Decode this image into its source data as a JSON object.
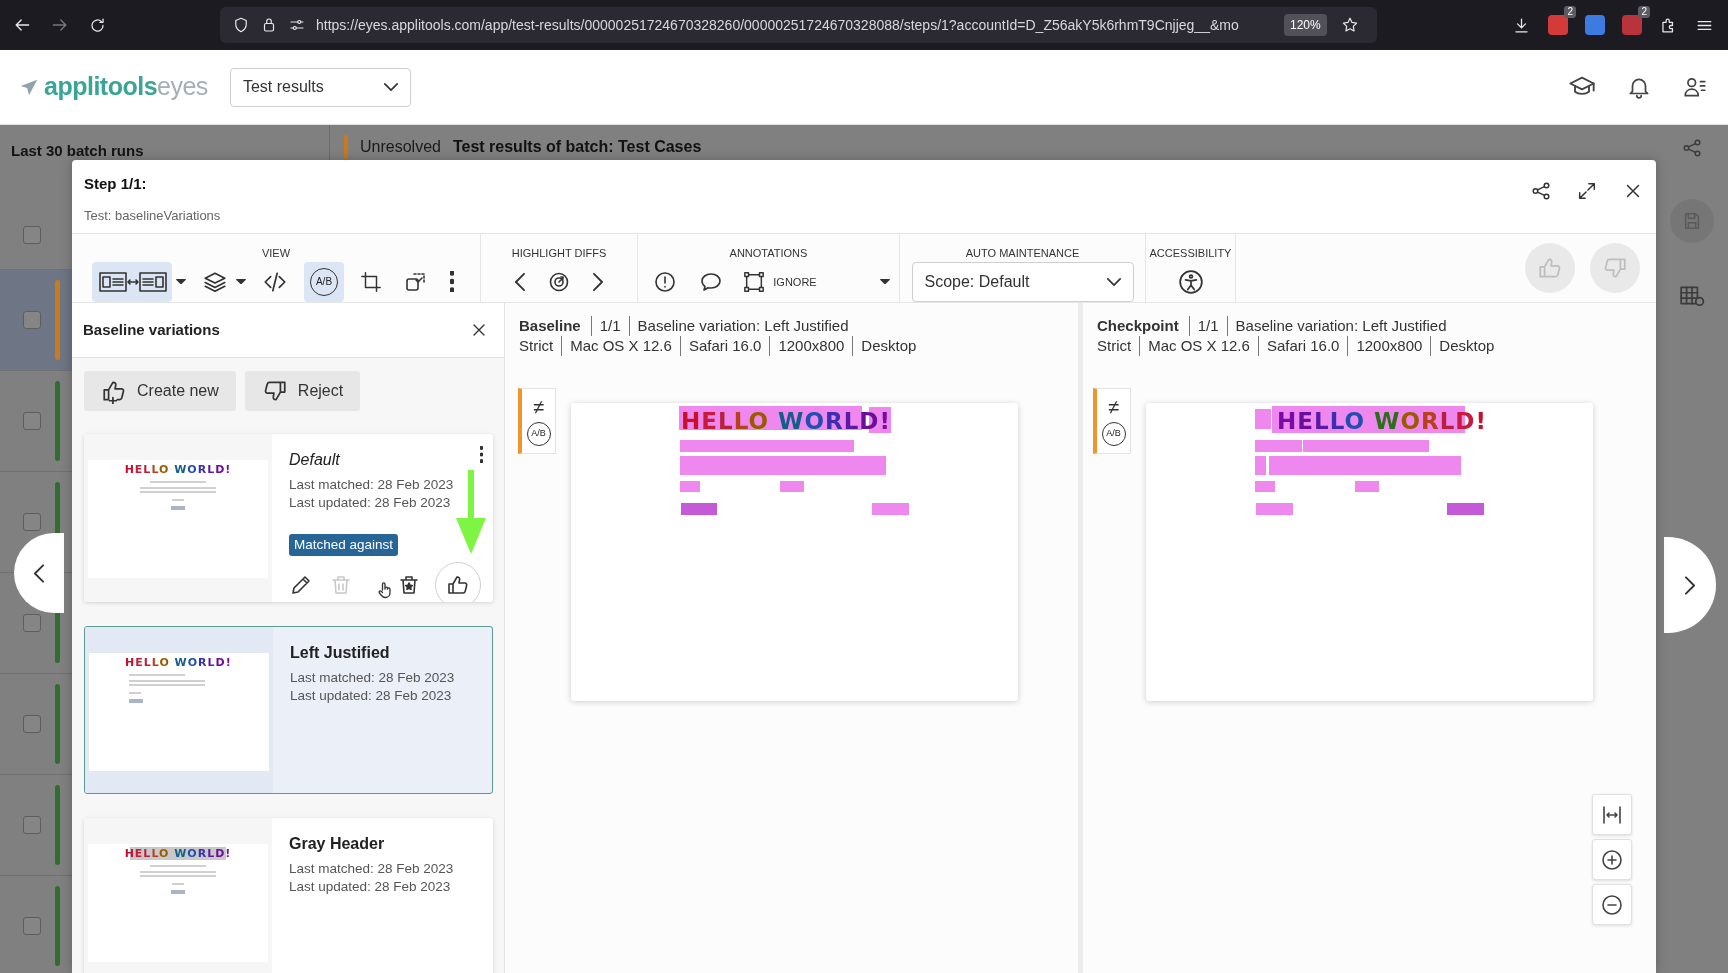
{
  "browser": {
    "url": "https://eyes.applitools.com/app/test-results/00000251724670328260/00000251724670328088/steps/1?accountId=D_Z56akY5k6rhmT9Cnjjeg__&mo",
    "zoom": "120%",
    "badges": [
      "2",
      "2"
    ]
  },
  "header": {
    "logo": "applitools",
    "logo_suffix": "eyes",
    "selector": "Test results"
  },
  "background": {
    "sidebar_title": "Last 30 batch runs",
    "status": "Unresolved",
    "title": "Test results of batch: Test Cases",
    "all_checked": false,
    "rows": [
      {
        "color": "#c97a1c",
        "selected": true,
        "checked": false
      },
      {
        "color": "#2f6e2f",
        "selected": false,
        "checked": false
      },
      {
        "color": "#2f6e2f",
        "selected": false,
        "checked": false
      },
      {
        "color": "#2f6e2f",
        "selected": false,
        "checked": false
      },
      {
        "color": "#2f6e2f",
        "selected": false,
        "checked": false
      },
      {
        "color": "#2f6e2f",
        "selected": false,
        "checked": false
      },
      {
        "color": "#2f6e2f",
        "selected": false,
        "checked": false
      }
    ]
  },
  "dialog": {
    "title": "Step 1/1:",
    "subtitle": "Test: baselineVariations",
    "toolbar": [
      {
        "label": "VIEW",
        "tools": [
          {
            "kind": "split",
            "selected": true,
            "dropdown": true
          },
          {
            "kind": "layers",
            "selected": false,
            "dropdown": true
          },
          {
            "kind": "code",
            "selected": false
          },
          {
            "kind": "ab",
            "text": "A/B",
            "selected": true
          },
          {
            "kind": "crop",
            "selected": false
          },
          {
            "kind": "region",
            "selected": false
          },
          {
            "kind": "more",
            "selected": false
          }
        ]
      },
      {
        "label": "HIGHLIGHT DIFFS",
        "tools": [
          {
            "kind": "prev"
          },
          {
            "kind": "target"
          },
          {
            "kind": "next"
          }
        ]
      },
      {
        "label": "ANNOTATIONS",
        "tools": [
          {
            "kind": "alert"
          },
          {
            "kind": "comment"
          },
          {
            "kind": "ignore",
            "text": "IGNORE"
          }
        ]
      },
      {
        "label": "AUTO MAINTENANCE",
        "tools": [
          {
            "kind": "select",
            "text": "Scope: Default"
          }
        ]
      },
      {
        "label": "ACCESSIBILITY",
        "tools": [
          {
            "kind": "accessibility"
          }
        ]
      }
    ],
    "panel": {
      "title": "Baseline variations",
      "actions": [
        {
          "kind": "approve",
          "label": "Create new"
        },
        {
          "kind": "reject",
          "label": "Reject"
        }
      ],
      "variations": [
        {
          "name": "Default",
          "kind": "default",
          "last_matched": "Last matched: 28 Feb 2023",
          "last_updated": "Last updated: 28 Feb 2023",
          "badge": "Matched against",
          "left_aligned": false,
          "gray_header": false,
          "heading": "HELLO WORLD!",
          "selected": false,
          "hovered": true,
          "arrow": true
        },
        {
          "name": "Left Justified",
          "kind": "custom",
          "last_matched": "Last matched: 28 Feb 2023",
          "last_updated": "Last updated: 28 Feb 2023",
          "left_aligned": true,
          "gray_header": false,
          "heading": "HELLO WORLD!",
          "selected": true,
          "hovered": false,
          "arrow": false
        },
        {
          "name": "Gray Header",
          "kind": "custom",
          "last_matched": "Last matched: 28 Feb 2023",
          "last_updated": "Last updated: 28 Feb 2023",
          "left_aligned": false,
          "gray_header": true,
          "heading": "HELLO WORLD!",
          "selected": false,
          "hovered": false,
          "arrow": false
        }
      ]
    },
    "panes": [
      {
        "kind": "baseline",
        "title": "Baseline",
        "index": "1/1",
        "variation": "Baseline variation: Left Justified",
        "details": [
          "Strict",
          "Mac OS X 12.6",
          "Safari 16.0",
          "1200x800",
          "Desktop"
        ],
        "side_tools": [
          "≠",
          "A/B"
        ],
        "heading": "HELLO WORLD!"
      },
      {
        "kind": "checkpoint",
        "title": "Checkpoint",
        "index": "1/1",
        "variation": "Baseline variation: Left Justified",
        "details": [
          "Strict",
          "Mac OS X 12.6",
          "Safari 16.0",
          "1200x800",
          "Desktop"
        ],
        "side_tools": [
          "≠",
          "A/B"
        ],
        "heading": "HELLO WORLD!"
      }
    ]
  }
}
